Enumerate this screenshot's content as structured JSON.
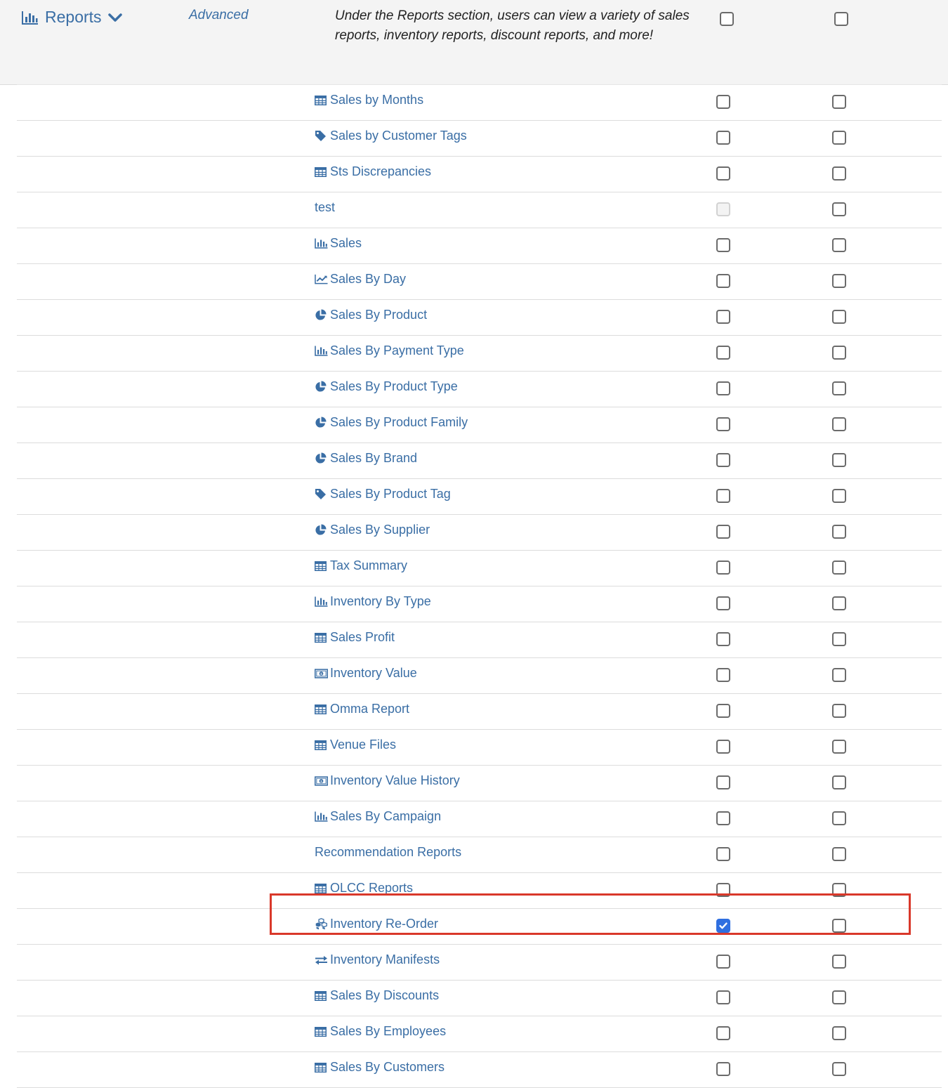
{
  "section": {
    "title": "Reports",
    "icon": "bar-chart-icon",
    "toggle_icon": "chevron-down-icon",
    "level": "Advanced",
    "description": "Under the Reports section, users can view a variety of sales reports, inventory reports, discount reports, and more!"
  },
  "colors": {
    "link": "#3a6ea5",
    "checked": "#2f6fe0",
    "highlight": "#d9382a"
  },
  "reports": [
    {
      "label": "Sales by Months",
      "icon": "table-icon",
      "col1": "unchecked",
      "col2": "unchecked"
    },
    {
      "label": "Sales by Customer Tags",
      "icon": "tag-icon",
      "col1": "unchecked",
      "col2": "unchecked"
    },
    {
      "label": "Sts Discrepancies",
      "icon": "table-icon",
      "col1": "unchecked",
      "col2": "unchecked"
    },
    {
      "label": "test",
      "icon": "",
      "col1": "disabled",
      "col2": "unchecked"
    },
    {
      "label": "Sales",
      "icon": "bar-chart-icon",
      "col1": "unchecked",
      "col2": "unchecked"
    },
    {
      "label": "Sales By Day",
      "icon": "line-chart-icon",
      "col1": "unchecked",
      "col2": "unchecked"
    },
    {
      "label": "Sales By Product",
      "icon": "pie-chart-icon",
      "col1": "unchecked",
      "col2": "unchecked"
    },
    {
      "label": "Sales By Payment Type",
      "icon": "bar-chart-icon",
      "col1": "unchecked",
      "col2": "unchecked"
    },
    {
      "label": "Sales By Product Type",
      "icon": "pie-chart-icon",
      "col1": "unchecked",
      "col2": "unchecked"
    },
    {
      "label": "Sales By Product Family",
      "icon": "pie-chart-icon",
      "col1": "unchecked",
      "col2": "unchecked"
    },
    {
      "label": "Sales By Brand",
      "icon": "pie-chart-icon",
      "col1": "unchecked",
      "col2": "unchecked"
    },
    {
      "label": "Sales By Product Tag",
      "icon": "tag-icon",
      "col1": "unchecked",
      "col2": "unchecked"
    },
    {
      "label": "Sales By Supplier",
      "icon": "pie-chart-icon",
      "col1": "unchecked",
      "col2": "unchecked"
    },
    {
      "label": "Tax Summary",
      "icon": "table-icon",
      "col1": "unchecked",
      "col2": "unchecked"
    },
    {
      "label": "Inventory By Type",
      "icon": "bar-chart-icon",
      "col1": "unchecked",
      "col2": "unchecked"
    },
    {
      "label": "Sales Profit",
      "icon": "table-icon",
      "col1": "unchecked",
      "col2": "unchecked"
    },
    {
      "label": "Inventory Value",
      "icon": "money-icon",
      "col1": "unchecked",
      "col2": "unchecked"
    },
    {
      "label": "Omma Report",
      "icon": "table-icon",
      "col1": "unchecked",
      "col2": "unchecked"
    },
    {
      "label": "Venue Files",
      "icon": "table-icon",
      "col1": "unchecked",
      "col2": "unchecked"
    },
    {
      "label": "Inventory Value History",
      "icon": "money-icon",
      "col1": "unchecked",
      "col2": "unchecked"
    },
    {
      "label": "Sales By Campaign",
      "icon": "bar-chart-icon",
      "col1": "unchecked",
      "col2": "unchecked"
    },
    {
      "label": "Recommendation Reports",
      "icon": "",
      "col1": "unchecked",
      "col2": "unchecked"
    },
    {
      "label": "OLCC Reports",
      "icon": "table-icon",
      "col1": "unchecked",
      "col2": "unchecked"
    },
    {
      "label": "Inventory Re-Order",
      "icon": "cubes-icon",
      "col1": "checked",
      "col2": "unchecked",
      "highlighted": true
    },
    {
      "label": "Inventory Manifests",
      "icon": "exchange-icon",
      "col1": "unchecked",
      "col2": "unchecked"
    },
    {
      "label": "Sales By Discounts",
      "icon": "table-icon",
      "col1": "unchecked",
      "col2": "unchecked"
    },
    {
      "label": "Sales By Employees",
      "icon": "table-icon",
      "col1": "unchecked",
      "col2": "unchecked"
    },
    {
      "label": "Sales By Customers",
      "icon": "table-icon",
      "col1": "unchecked",
      "col2": "unchecked"
    }
  ]
}
